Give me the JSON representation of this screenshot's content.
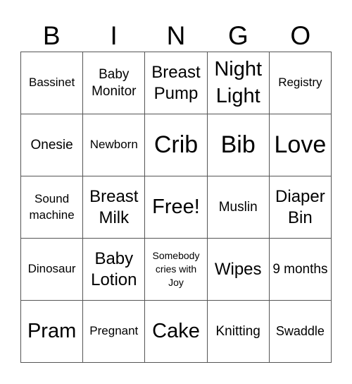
{
  "header": [
    "B",
    "I",
    "N",
    "G",
    "O"
  ],
  "cells": [
    [
      "Bassinet",
      "Baby Monitor",
      "Breast Pump",
      "Night Light",
      "Registry"
    ],
    [
      "Onesie",
      "Newborn",
      "Crib",
      "Bib",
      "Love"
    ],
    [
      "Sound machine",
      "Breast Milk",
      "Free!",
      "Muslin",
      "Diaper Bin"
    ],
    [
      "Dinosaur",
      "Baby Lotion",
      "Somebody cries with Joy",
      "Wipes",
      "9 months"
    ],
    [
      "Pram",
      "Pregnant",
      "Cake",
      "Knitting",
      "Swaddle"
    ]
  ]
}
